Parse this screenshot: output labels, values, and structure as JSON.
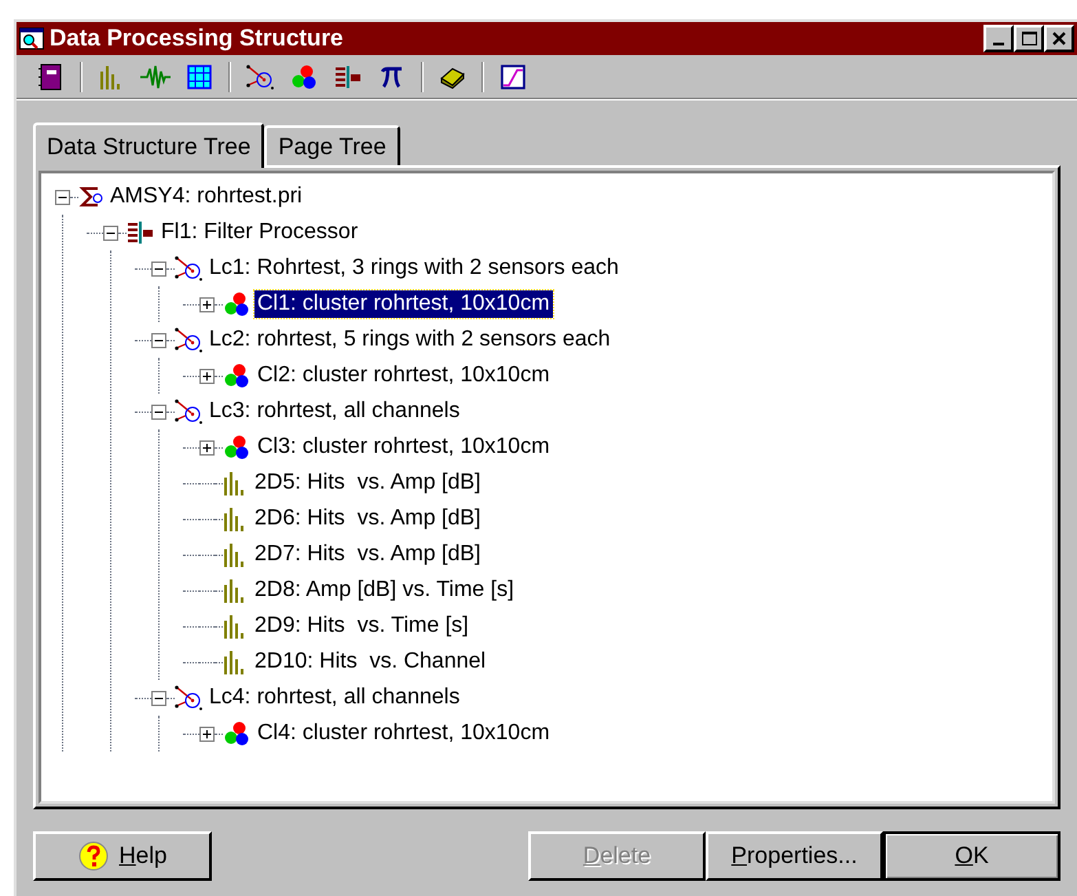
{
  "window": {
    "title": "Data Processing Structure"
  },
  "toolbar": [
    {
      "kind": "notebook"
    },
    {
      "kind": "sep"
    },
    {
      "kind": "histogram"
    },
    {
      "kind": "wave"
    },
    {
      "kind": "grid"
    },
    {
      "kind": "sep"
    },
    {
      "kind": "location"
    },
    {
      "kind": "cluster"
    },
    {
      "kind": "filter"
    },
    {
      "kind": "pi"
    },
    {
      "kind": "sep"
    },
    {
      "kind": "book"
    },
    {
      "kind": "sep"
    },
    {
      "kind": "curve"
    }
  ],
  "tabs": [
    {
      "label": "Data Structure Tree",
      "selected": true
    },
    {
      "label": "Page Tree",
      "selected": false
    }
  ],
  "tree": [
    {
      "kind": "sum",
      "label": "AMSY4: rohrtest.pri",
      "expanded": true,
      "selected": false,
      "children": [
        {
          "kind": "filter",
          "label": "Fl1: Filter Processor",
          "expanded": true,
          "selected": false,
          "children": [
            {
              "kind": "location",
              "label": "Lc1: Rohrtest, 3 rings with 2 sensors each",
              "expanded": true,
              "selected": false,
              "children": [
                {
                  "kind": "cluster",
                  "label": "Cl1: cluster rohrtest, 10x10cm",
                  "expanded": false,
                  "selected": true
                }
              ]
            },
            {
              "kind": "location",
              "label": "Lc2: rohrtest, 5 rings with 2 sensors each",
              "expanded": true,
              "selected": false,
              "children": [
                {
                  "kind": "cluster",
                  "label": "Cl2: cluster rohrtest, 10x10cm",
                  "expanded": false,
                  "selected": false
                }
              ]
            },
            {
              "kind": "location",
              "label": "Lc3: rohrtest, all channels",
              "expanded": true,
              "selected": false,
              "children": [
                {
                  "kind": "cluster",
                  "label": "Cl3: cluster rohrtest, 10x10cm",
                  "expanded": false,
                  "selected": false
                },
                {
                  "kind": "histogram",
                  "label": "2D5: Hits  vs. Amp [dB]",
                  "selected": false
                },
                {
                  "kind": "histogram",
                  "label": "2D6: Hits  vs. Amp [dB]",
                  "selected": false
                },
                {
                  "kind": "histogram",
                  "label": "2D7: Hits  vs. Amp [dB]",
                  "selected": false
                },
                {
                  "kind": "histogram",
                  "label": "2D8: Amp [dB] vs. Time [s]",
                  "selected": false
                },
                {
                  "kind": "histogram",
                  "label": "2D9: Hits  vs. Time [s]",
                  "selected": false
                },
                {
                  "kind": "histogram",
                  "label": "2D10: Hits  vs. Channel",
                  "selected": false
                }
              ]
            },
            {
              "kind": "location",
              "label": "Lc4: rohrtest, all channels",
              "expanded": true,
              "selected": false,
              "children": [
                {
                  "kind": "cluster",
                  "label": "Cl4: cluster rohrtest, 10x10cm",
                  "expanded": false,
                  "selected": false
                }
              ]
            }
          ]
        }
      ]
    }
  ],
  "buttons": [
    {
      "kind": "help",
      "accel": "H",
      "rest": "elp",
      "disabled": false
    },
    {
      "kind": "plain",
      "accel": "D",
      "rest": "elete",
      "disabled": true
    },
    {
      "kind": "plain",
      "accel": "P",
      "rest": "roperties...",
      "disabled": false
    },
    {
      "kind": "default",
      "accel": "O",
      "rest": "K",
      "disabled": false
    }
  ]
}
